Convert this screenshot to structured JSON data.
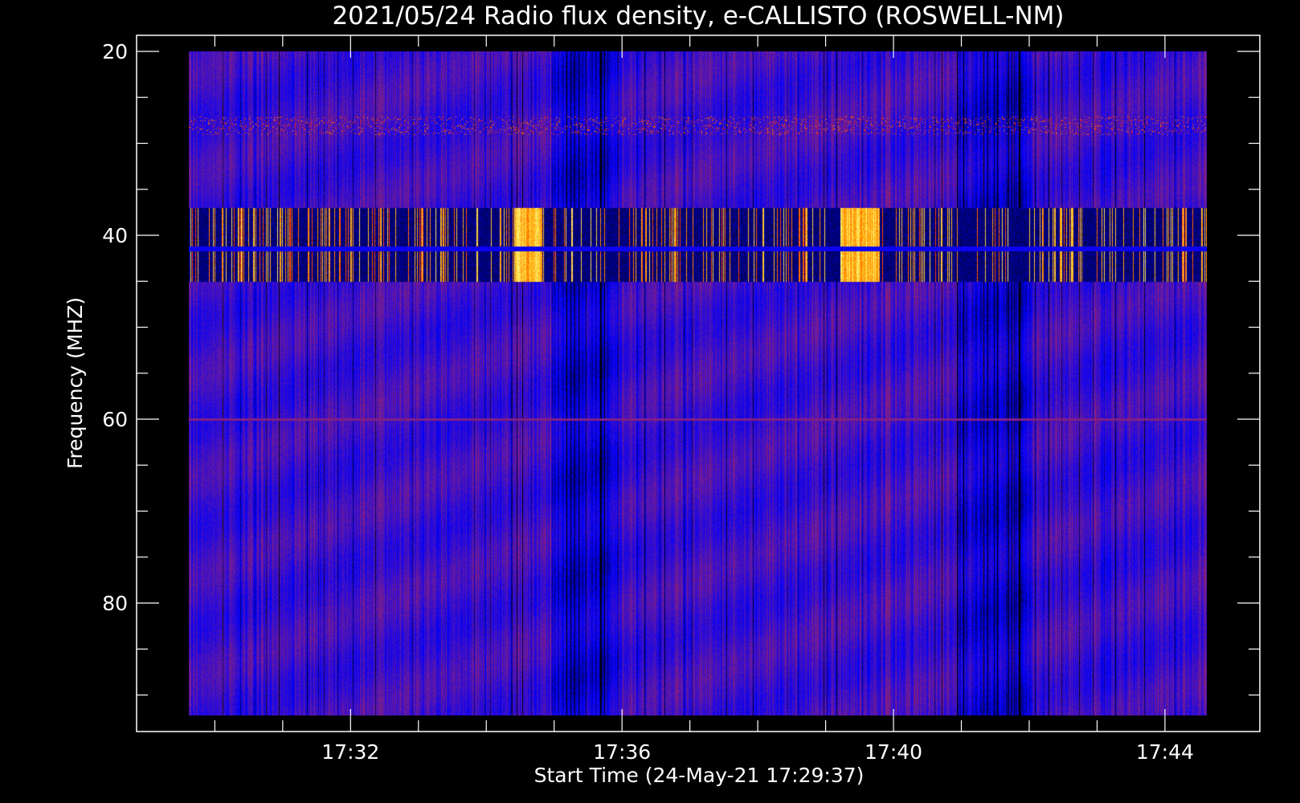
{
  "chart_data": {
    "type": "heatmap",
    "title": "2021/05/24  Radio flux density, e-CALLISTO (ROSWELL-NM)",
    "xlabel": "Start Time (24-May-21 17:29:37)",
    "ylabel": "Frequency (MHZ)",
    "x_ticks": [
      "17:32",
      "17:36",
      "17:40",
      "17:44"
    ],
    "y_ticks": [
      "20",
      "40",
      "60",
      "80"
    ],
    "x_range": [
      "17:29:37",
      "17:44:37"
    ],
    "y_range": [
      20,
      92
    ],
    "y_inverted": true,
    "colormap": [
      "#000000",
      "#0000ff",
      "#7a1f8c",
      "#ff1a00",
      "#ffa000",
      "#ffff80"
    ],
    "features": {
      "strong_emission_band_mhz": [
        37,
        45
      ],
      "weak_band_mhz": [
        27,
        29
      ],
      "interference_line_mhz": 60
    }
  }
}
